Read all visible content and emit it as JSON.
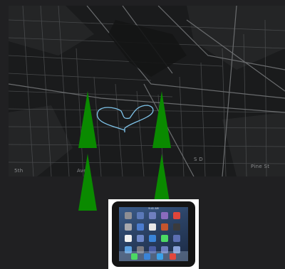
{
  "map": {
    "labels": [
      "S D",
      "Pine St",
      "5th",
      "Ave"
    ],
    "theme_colors": {
      "background": "#1a1b1c",
      "roads": "#5a5c5e",
      "route": "#7fc4ea"
    }
  },
  "markers": {
    "color": "#0a8a00",
    "count": 4
  },
  "tablet_preview": {
    "status_text": "9:41 AM",
    "home_icon_colors": [
      "#8e8e93",
      "#5b79b8",
      "#6f7fbf",
      "#8a6bbd",
      "#e0453a",
      "#a8a8ad",
      "#4b7ccf",
      "#e8e8e8",
      "#c4552e",
      "#3a3a3c",
      "#f2f2f2",
      "#6d87c8",
      "#3a84d8",
      "#4cd964",
      "#5c6fb3",
      "#5ba0e0",
      "#7a7a80",
      "#4a5da3",
      "#6e7fc0",
      "#89a1d8"
    ],
    "dock_icon_colors": [
      "#4cd964",
      "#3a84d8",
      "#3aa0e8",
      "#e2473d"
    ]
  }
}
